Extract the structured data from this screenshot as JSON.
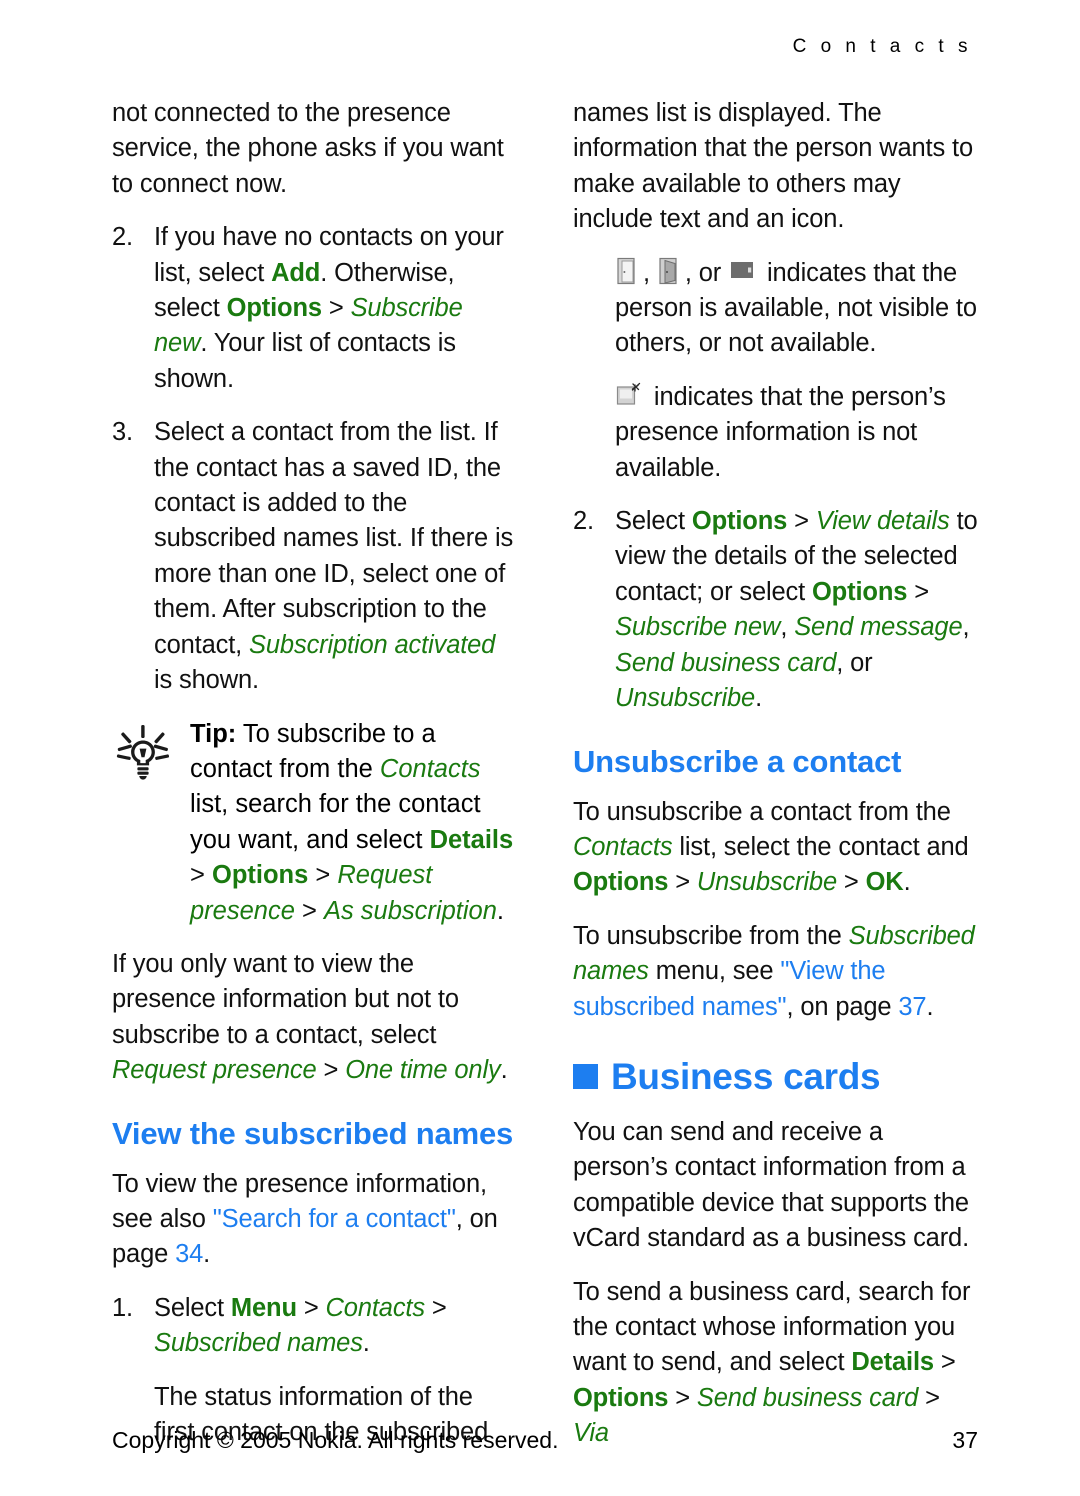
{
  "header": {
    "running_head": "C o n t a c t s"
  },
  "left_column": {
    "para_continued": {
      "t1": "not connected to the presence service, the phone asks if you want to connect now."
    },
    "step2": {
      "number": "2.",
      "t1": "If you have no contacts on your list, select ",
      "k1": "Add",
      "t2": ". Otherwise, select ",
      "k2": "Options",
      "sep1": " > ",
      "m1": "Subscribe new",
      "t3": ". Your list of contacts is shown."
    },
    "step3": {
      "number": "3.",
      "t1": "Select a contact from the list. If the contact has a saved ID, the contact is added to the subscribed names list. If there is more than one ID, select one of them. After subscription to the contact, ",
      "m1": "Subscription activated",
      "t2": " is shown."
    },
    "tip": {
      "icon": "lightbulb-icon",
      "label": "Tip:",
      "t1": " To subscribe to a contact from the ",
      "m1": "Contacts",
      "t2": " list, search for the contact you want, and select ",
      "k1": "Details",
      "sep1": " > ",
      "k2": "Options",
      "sep2": " > ",
      "m2": "Request presence",
      "sep3": " > ",
      "m3": "As subscription",
      "t3": "."
    },
    "para_viewonly": {
      "t1": "If you only want to view the presence information but not to subscribe to a contact, select ",
      "m1": "Request presence",
      "sep1": " > ",
      "m2": "One time only",
      "t2": "."
    },
    "heading_view": "View the subscribed names",
    "para_see_also": {
      "t1": "To view the presence information, see also ",
      "link": "\"Search for a contact\"",
      "t2": ", on page ",
      "pagelink": "34",
      "t3": "."
    },
    "step1": {
      "number": "1.",
      "t1": "Select ",
      "k1": "Menu",
      "sep1": " > ",
      "m1": "Contacts",
      "sep2": " > ",
      "m2": "Subscribed names",
      "t2": "."
    },
    "step1_cont": "The status information of the first contact on the subscribed"
  },
  "right_column": {
    "para_cont": "names list is displayed. The information that the person wants to make available to others may include text and an icon.",
    "para_icons": {
      "icon1": "door-open-icon",
      "sep1": ", ",
      "icon2": "door-ajar-icon",
      "sep2": ", or ",
      "icon3": "door-closed-icon",
      "t1": " indicates that the person is available, not visible to others, or not available."
    },
    "para_notavail": {
      "icon": "presence-unavailable-icon",
      "t1": " indicates that the person’s presence information is not available."
    },
    "step2": {
      "number": "2.",
      "t1": "Select ",
      "k1": "Options",
      "sep1": " > ",
      "m1": "View details",
      "t2": " to view the details of the selected contact; or select ",
      "k2": "Options",
      "sep2": " > ",
      "m2": "Subscribe new",
      "c1": ", ",
      "m3": "Send message",
      "c2": ", ",
      "m4": "Send business card",
      "t3": ", or ",
      "m5": "Unsubscribe",
      "t4": "."
    },
    "heading_unsubscribe": "Unsubscribe a contact",
    "para_unsub1": {
      "t1": "To unsubscribe a contact from the ",
      "m1": "Contacts",
      "t2": " list, select the contact and ",
      "k1": "Options",
      "sep1": " > ",
      "m2": "Unsubscribe",
      "sep2": " > ",
      "k2": "OK",
      "t3": "."
    },
    "para_unsub2": {
      "t1": "To unsubscribe from the ",
      "m1": "Subscribed names",
      "t2": " menu, see ",
      "link": "\"View the subscribed names\"",
      "t3": ", on page ",
      "pagelink": "37",
      "t4": "."
    },
    "heading_business": "Business cards",
    "para_business1": "You can send and receive a person’s contact information from a compatible device that supports the vCard standard as a business card.",
    "para_business2": {
      "t1": "To send a business card, search for the contact whose information you want to send, and select ",
      "k1": "Details",
      "sep1": " > ",
      "k2": "Options",
      "sep2": " > ",
      "m1": "Send business card",
      "sep3": " > ",
      "m2": "Via"
    }
  },
  "footer": {
    "copyright": "Copyright © 2005 Nokia. All rights reserved.",
    "page_number": "37"
  },
  "colors": {
    "heading_blue": "#1d7ef0",
    "menu_green": "#1a7a10",
    "link_blue": "#1d7ef0",
    "body_black": "#111111"
  }
}
